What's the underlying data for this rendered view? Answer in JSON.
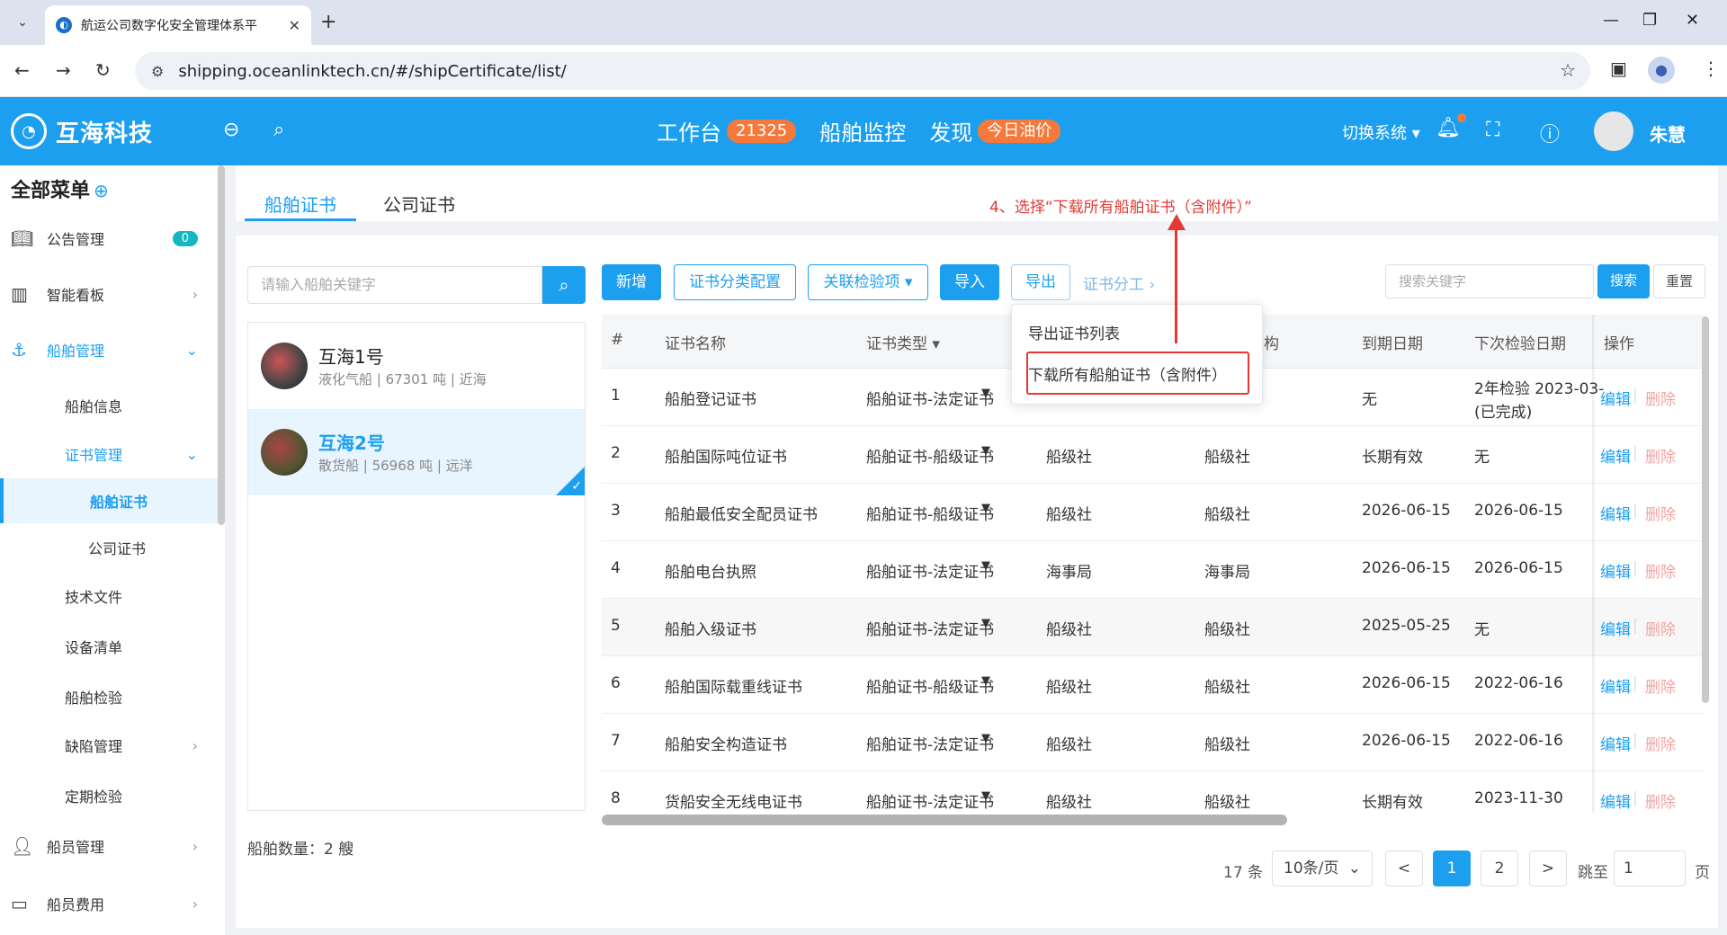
{
  "browser": {
    "tab_title": "航运公司数字化安全管理体系平",
    "url": "shipping.oceanlinktech.cn/#/shipCertificate/list/"
  },
  "header": {
    "brand": "互海科技",
    "nav": [
      {
        "label": "工作台",
        "badge": "21325"
      },
      {
        "label": "船舶监控",
        "badge": ""
      },
      {
        "label": "发现",
        "badge": "今日油价"
      }
    ],
    "switch_system": "切换系统",
    "user_name": "朱慧"
  },
  "sidebar": {
    "title": "全部菜单",
    "items": [
      {
        "label": "公告管理",
        "badge": "0"
      },
      {
        "label": "智能看板"
      },
      {
        "label": "船舶管理"
      },
      {
        "label": "船舶信息"
      },
      {
        "label": "证书管理"
      },
      {
        "label": "船舶证书"
      },
      {
        "label": "公司证书"
      },
      {
        "label": "技术文件"
      },
      {
        "label": "设备清单"
      },
      {
        "label": "船舶检验"
      },
      {
        "label": "缺陷管理"
      },
      {
        "label": "定期检验"
      },
      {
        "label": "船员管理"
      },
      {
        "label": "船员费用"
      }
    ]
  },
  "page_tabs": [
    "船舶证书",
    "公司证书"
  ],
  "annotation": "4、选择“下载所有船舶证书（含附件）”",
  "ship_panel": {
    "search_placeholder": "请输入船舶关键字",
    "ships": [
      {
        "name": "互海1号",
        "meta": "液化气船 | 67301 吨 | 近海"
      },
      {
        "name": "互海2号",
        "meta": "散货船 | 56968 吨 | 远洋"
      }
    ],
    "count_label": "船舶数量：2 艘"
  },
  "toolbar": {
    "add": "新增",
    "category": "证书分类配置",
    "related": "关联检验项",
    "import": "导入",
    "export": "导出",
    "assign": "证书分工",
    "search_placeholder": "搜索关键字",
    "search": "搜索",
    "reset": "重置"
  },
  "export_menu": [
    "导出证书列表",
    "下载所有船舶证书（含附件）"
  ],
  "table": {
    "headers": [
      "#",
      "证书名称",
      "证书类型",
      "",
      "构",
      "到期日期",
      "下次检验日期",
      "操作"
    ],
    "rows": [
      {
        "no": "1",
        "name": "船舶登记证书",
        "type": "船舶证书-法定证书",
        "issuer": "",
        "org": "",
        "expire": "无",
        "next": "2年检验 2023-03-",
        "next2": "(已完成)"
      },
      {
        "no": "2",
        "name": "船舶国际吨位证书",
        "type": "船舶证书-船级证书",
        "issuer": "船级社",
        "org": "船级社",
        "expire": "长期有效",
        "next": "无",
        "next2": ""
      },
      {
        "no": "3",
        "name": "船舶最低安全配员证书",
        "type": "船舶证书-船级证书",
        "issuer": "船级社",
        "org": "船级社",
        "expire": "2026-06-15",
        "next": "2026-06-15",
        "next2": ""
      },
      {
        "no": "4",
        "name": "船舶电台执照",
        "type": "船舶证书-法定证书",
        "issuer": "海事局",
        "org": "海事局",
        "expire": "2026-06-15",
        "next": "2026-06-15",
        "next2": ""
      },
      {
        "no": "5",
        "name": "船舶入级证书",
        "type": "船舶证书-法定证书",
        "issuer": "船级社",
        "org": "船级社",
        "expire": "2025-05-25",
        "next": "无",
        "next2": ""
      },
      {
        "no": "6",
        "name": "船舶国际载重线证书",
        "type": "船舶证书-船级证书",
        "issuer": "船级社",
        "org": "船级社",
        "expire": "2026-06-15",
        "next": "2022-06-16",
        "next2": ""
      },
      {
        "no": "7",
        "name": "船舶安全构造证书",
        "type": "船舶证书-法定证书",
        "issuer": "船级社",
        "org": "船级社",
        "expire": "2026-06-15",
        "next": "2022-06-16",
        "next2": ""
      },
      {
        "no": "8",
        "name": "货船安全无线电证书",
        "type": "船舶证书-法定证书",
        "issuer": "船级社",
        "org": "船级社",
        "expire": "长期有效",
        "next": "2023-11-30",
        "next2": ""
      }
    ],
    "edit": "编辑",
    "delete": "删除"
  },
  "pagination": {
    "total": "17 条",
    "page_size": "10条/页",
    "pages": [
      "1",
      "2"
    ],
    "goto_label": "跳至",
    "goto_value": "1",
    "page_unit": "页"
  }
}
